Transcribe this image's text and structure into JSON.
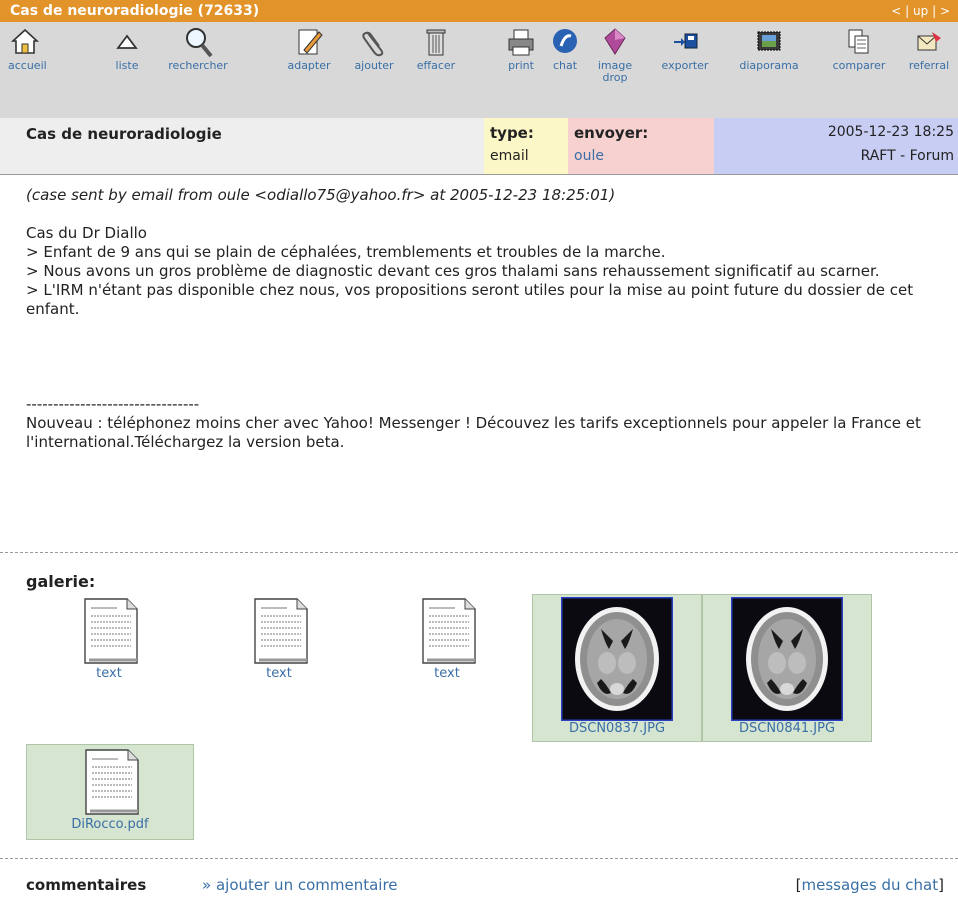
{
  "titlebar": {
    "title": "Cas de neuroradiologie (72633)",
    "nav_prev": "<",
    "nav_sep1": "|",
    "nav_up": "up",
    "nav_sep2": "|",
    "nav_next": ">"
  },
  "toolbar": [
    {
      "label": "accueil",
      "icon": "home-icon"
    },
    {
      "label": "liste",
      "icon": "up-triangle-icon"
    },
    {
      "label": "rechercher",
      "icon": "magnifier-icon"
    },
    {
      "label": "adapter",
      "icon": "edit-icon"
    },
    {
      "label": "ajouter",
      "icon": "paperclip-icon"
    },
    {
      "label": "effacer",
      "icon": "trash-icon"
    },
    {
      "label": "print",
      "icon": "printer-icon"
    },
    {
      "label": "chat",
      "icon": "chat-icon"
    },
    {
      "label": "image",
      "label2": "drop",
      "icon": "image-drop-icon"
    },
    {
      "label": "exporter",
      "icon": "export-icon"
    },
    {
      "label": "diaporama",
      "icon": "slideshow-icon"
    },
    {
      "label": "comparer",
      "icon": "compare-icon"
    },
    {
      "label": "referral",
      "icon": "referral-icon"
    }
  ],
  "info": {
    "title": "Cas de neuroradiologie",
    "type_label": "type:",
    "type_value": "email",
    "sender_label": "envoyer:",
    "sender_value": "oule",
    "date": "2005-12-23 18:25",
    "forum": "RAFT - Forum"
  },
  "body": {
    "meta": "(case sent by email from oule <odiallo75@yahoo.fr> at 2005-12-23 18:25:01)",
    "lines": [
      "Cas du Dr Diallo",
      "> Enfant de 9 ans qui se plain de céphalées, tremblements et troubles de la marche.",
      "> Nous avons un gros problème de diagnostic devant ces gros thalami sans rehaussement significatif au scarner.",
      "> L'IRM n'étant pas disponible chez nous, vos propositions seront utiles pour la mise au point future du dossier de cet enfant."
    ],
    "separator": "--------------------------------",
    "footer": "Nouveau : téléphonez moins cher avec Yahoo! Messenger ! Découvez les tarifs exceptionnels pour appeler la France et l'international.Téléchargez la version beta."
  },
  "gallery": {
    "label": "galerie:",
    "items": [
      {
        "name": "text",
        "kind": "document"
      },
      {
        "name": "text",
        "kind": "document"
      },
      {
        "name": "text",
        "kind": "document"
      },
      {
        "name": "DSCN0837.JPG",
        "kind": "ct-scan"
      },
      {
        "name": "DSCN0841.JPG",
        "kind": "ct-scan"
      },
      {
        "name": "DiRocco.pdf",
        "kind": "document"
      }
    ]
  },
  "comments": {
    "label": "commentaires",
    "add_prefix": "»",
    "add_link": "ajouter un commentaire",
    "chat_open": "[",
    "chat_link": "messages du chat",
    "chat_close": "]"
  },
  "colors": {
    "titlebar": "#e2932a",
    "toolbar": "#d8d8d8",
    "link": "#3a6fa6",
    "type_bg": "#fbf7c6",
    "sender_bg": "#f7d0d0",
    "date_bg": "#c7cdf3",
    "thumb_bg": "#d6e5d0"
  }
}
